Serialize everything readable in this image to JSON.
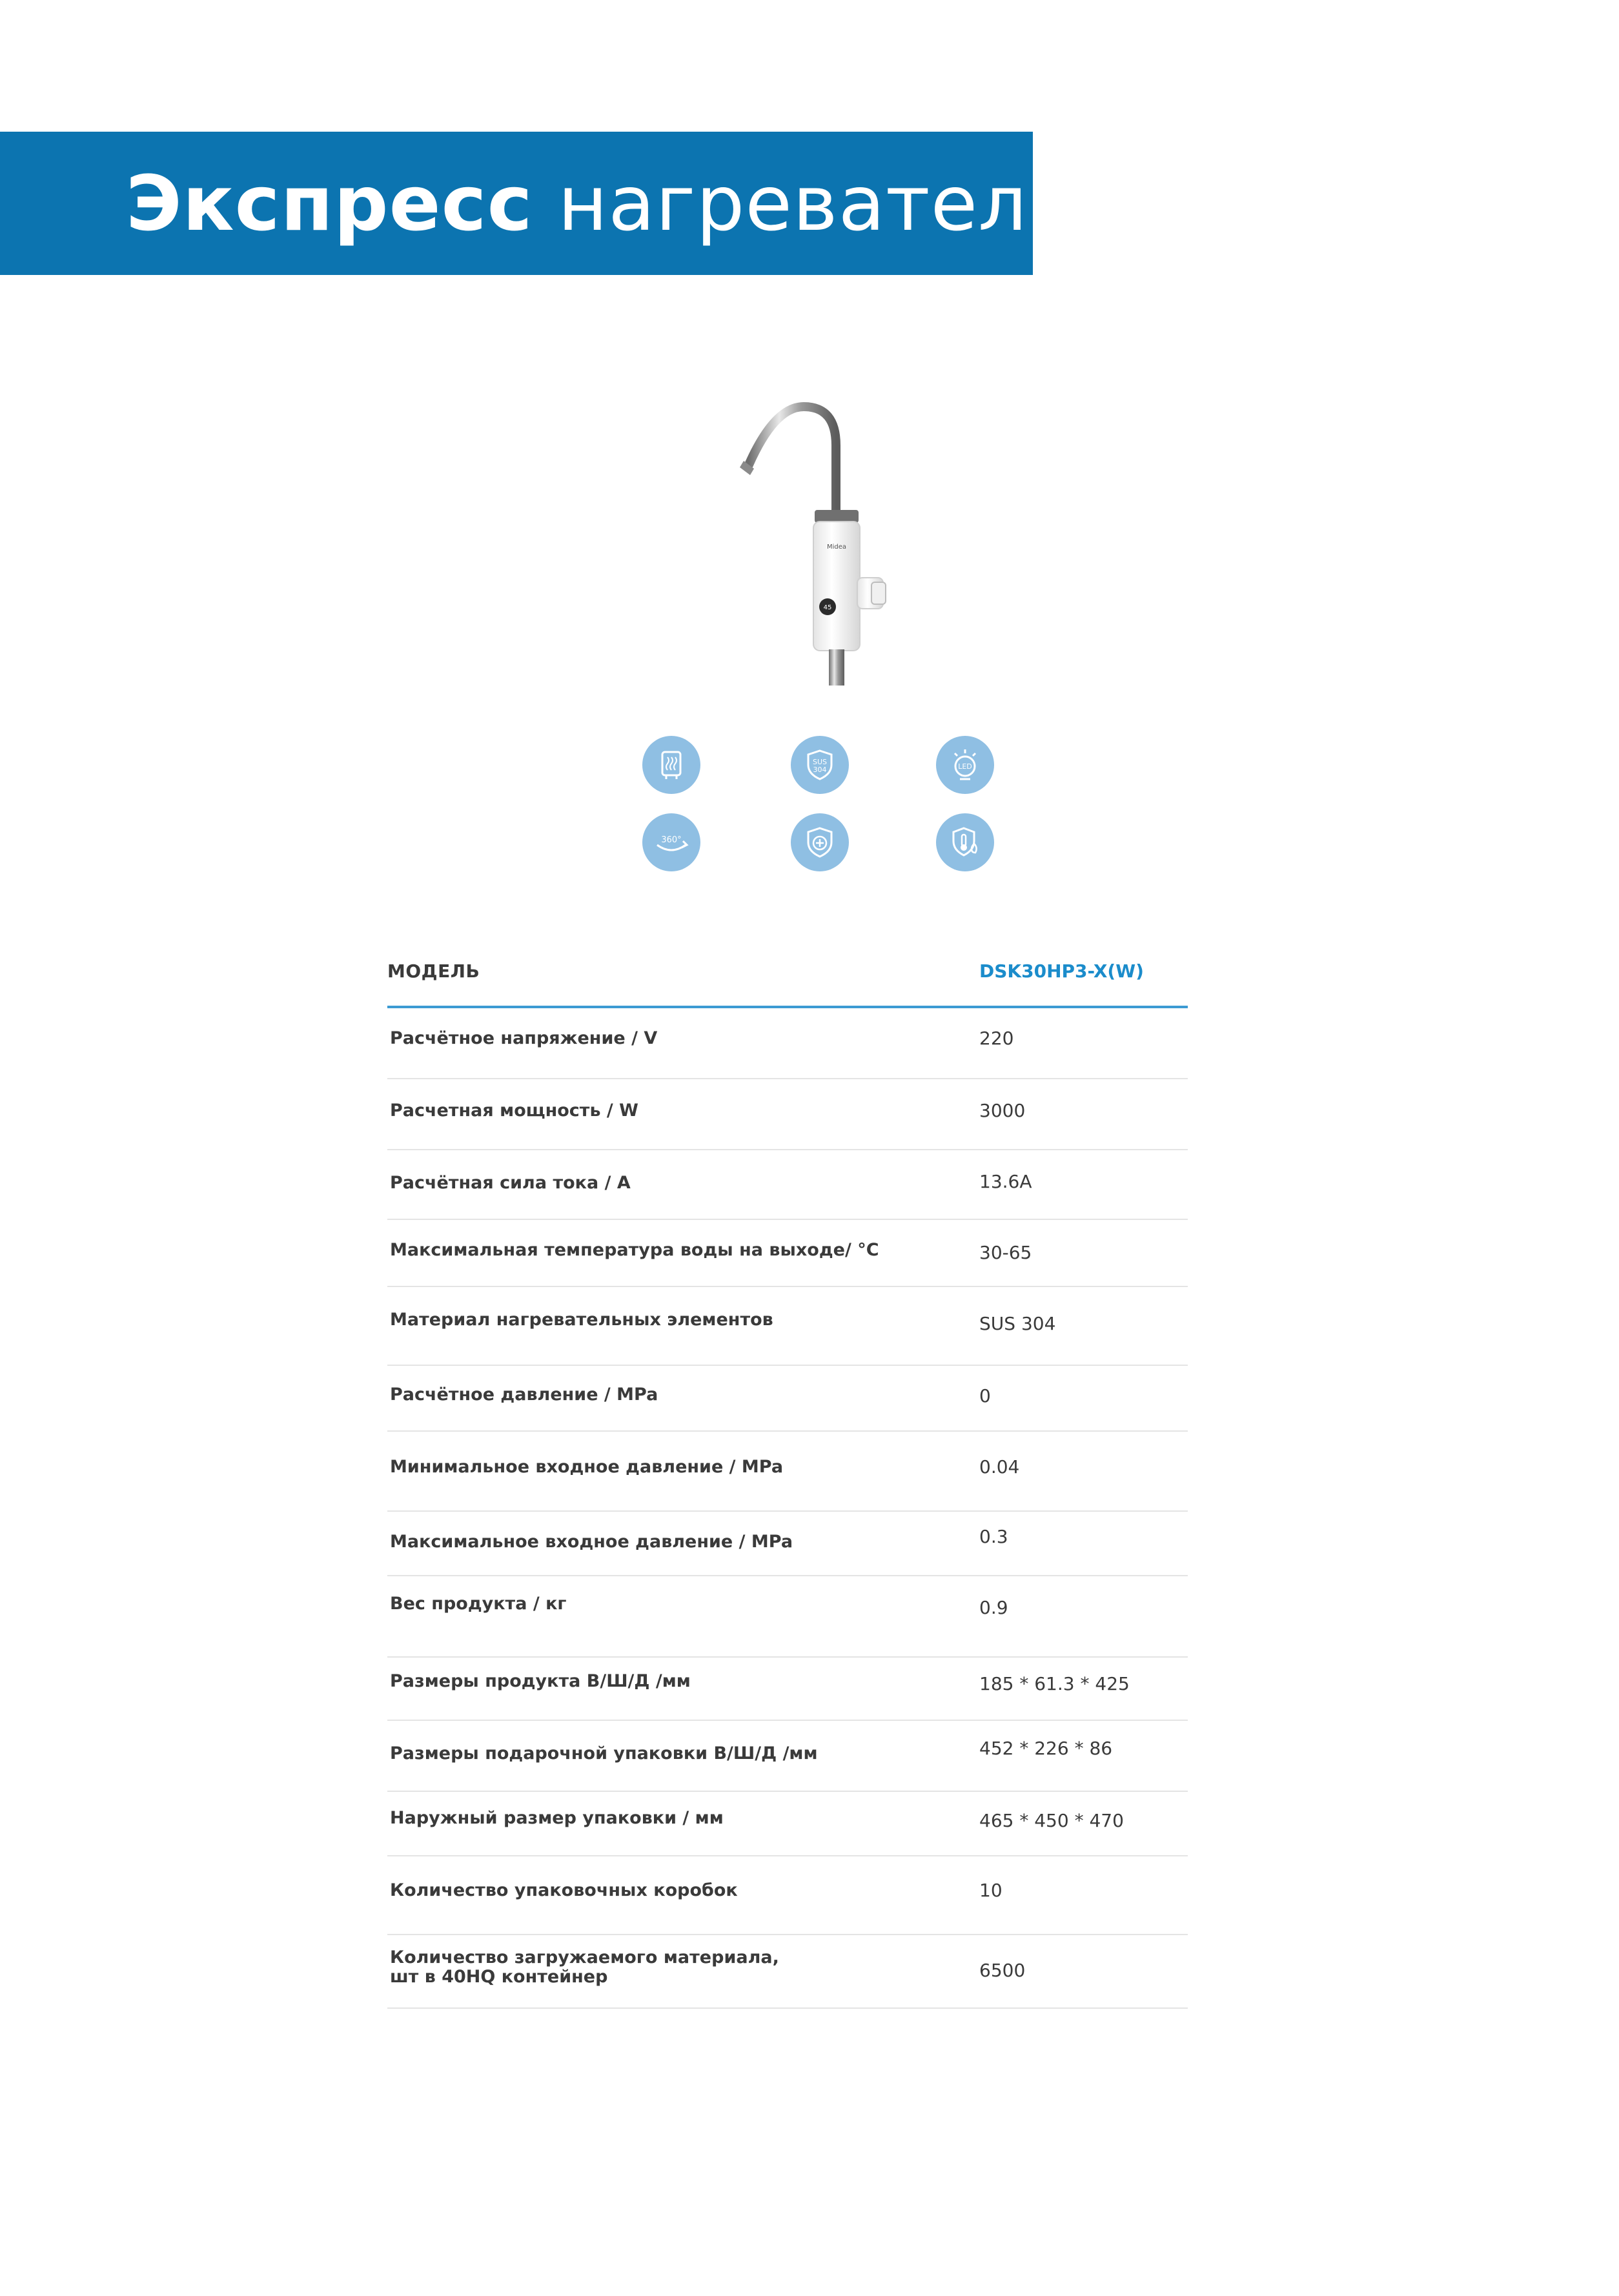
{
  "header": {
    "title_bold": "Экспресс",
    "title_rest": "нагреватели",
    "banner_color": "#0c74b0"
  },
  "product": {
    "brand_mark": "Midea",
    "display_value": "45"
  },
  "features": [
    {
      "icon": "heating-element-icon"
    },
    {
      "icon": "sus304-shield-icon",
      "text_top": "SUS",
      "text_bottom": "304"
    },
    {
      "icon": "led-display-icon",
      "text": "LED"
    },
    {
      "icon": "rotate-360-icon",
      "text": "360°"
    },
    {
      "icon": "safety-shield-icon"
    },
    {
      "icon": "temperature-protection-icon"
    }
  ],
  "specs": {
    "header_label": "МОДЕЛЬ",
    "model": "DSK30HP3-X(W)",
    "accent_color": "#1b8ccb",
    "rows": [
      {
        "label": "Расчётное напряжение / V",
        "value": "220"
      },
      {
        "label": "Расчетная мощность / W",
        "value": "3000"
      },
      {
        "label": "Расчётная сила тока / А",
        "value": "13.6A"
      },
      {
        "label": "Максимальная температура воды на выходе/  °C",
        "value": "30-65"
      },
      {
        "label": "Материал нагревательных элементов",
        "value": "SUS 304"
      },
      {
        "label": "Расчётное давление / MPa",
        "value": "0"
      },
      {
        "label": "Минимальное входное давление / MPa",
        "value": "0.04"
      },
      {
        "label": "Максимальное входное давление / MPa",
        "value": "0.3"
      },
      {
        "label": "Вес продукта /  кг",
        "value": "0.9"
      },
      {
        "label": "Размеры продукта В/Ш/Д /мм",
        "value": "185 * 61.3 * 425"
      },
      {
        "label": "Размеры подарочной упаковки В/Ш/Д /мм",
        "value": "452 * 226 * 86"
      },
      {
        "label": "Наружный размер упаковки / мм",
        "value": "465 * 450 * 470"
      },
      {
        "label": "Количество упаковочных коробок",
        "value": "10"
      },
      {
        "label": "Количество загружаемого материала,\nшт в 40HQ контейнер",
        "value": "6500"
      }
    ]
  }
}
